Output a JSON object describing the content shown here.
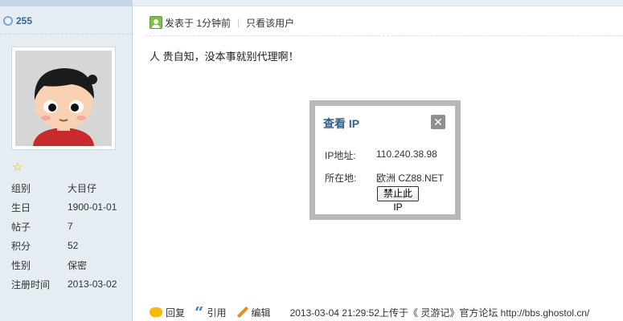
{
  "profile": {
    "uid": "255",
    "info": [
      {
        "key": "组别",
        "value": "大目仔"
      },
      {
        "key": "生日",
        "value": "1900-01-01"
      },
      {
        "key": "帖子",
        "value": "7"
      },
      {
        "key": "积分",
        "value": "52"
      },
      {
        "key": "性别",
        "value": "保密"
      },
      {
        "key": "注册时间",
        "value": "2013-03-02"
      }
    ]
  },
  "post": {
    "posted_time": "发表于 1分钟前",
    "only_author": "只看该用户",
    "content": "人 贵自知，没本事就别代理啊！"
  },
  "ip_popup": {
    "title": "查看 IP",
    "close": "✕",
    "ip_label": "IP地址:",
    "ip_value": "110.240.38.98",
    "location_label": "所在地:",
    "location_value": "欧洲 CZ88.NET",
    "ban_button": "禁止此 IP"
  },
  "footer": {
    "reply": "回复",
    "quote": "引用",
    "edit": "编辑",
    "info": "2013-03-04 21:29:52上传于《 灵游记》官方论坛  http://bbs.ghostol.cn/"
  },
  "icons": {
    "online": "online-status-icon",
    "star": "star-icon",
    "post": "user-icon",
    "reply": "reply-icon",
    "quote": "quote-icon",
    "edit": "pencil-icon"
  }
}
